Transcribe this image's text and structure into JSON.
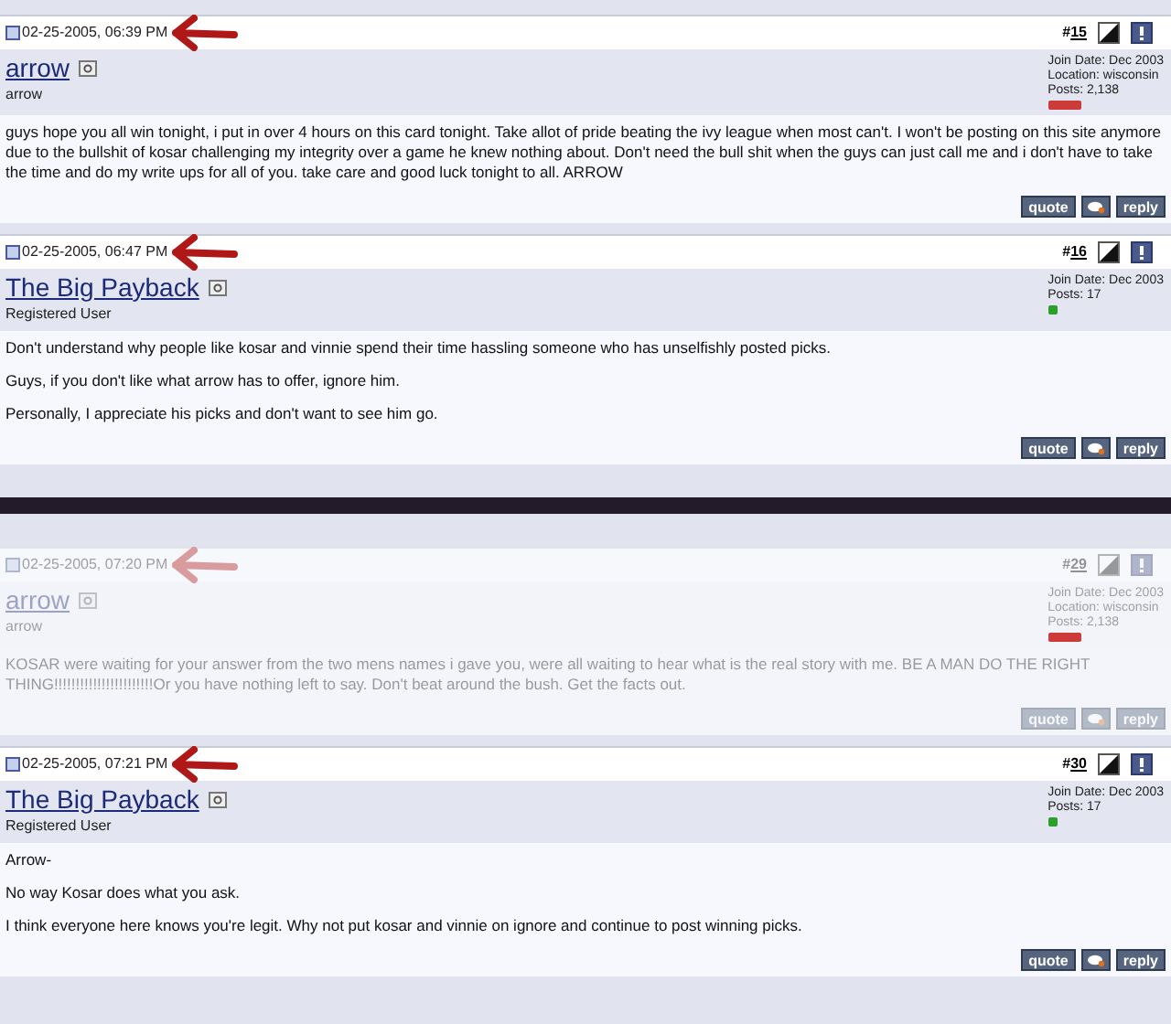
{
  "posts": [
    {
      "date": "02-25-2005, 06:39 PM",
      "hash": "#",
      "number": "15",
      "username": "arrow",
      "user_title": "arrow",
      "faded": false,
      "color": "#cc3a3a",
      "stats": [
        "Join Date: Dec 2003",
        "Location: wisconsin",
        "Posts: 2,138"
      ],
      "paragraphs": [
        "guys hope you all win tonight, i put in over 4 hours on this card tonight. Take allot of pride beating the ivy league when most can't. I won't be posting on this site anymore due to the bullshit of kosar challenging my integrity over a game he knew nothing about. Don't need the bull shit when the guys can just call me and i don't have to take the time and do my write ups for all of you. take care and good luck tonight to all. ARROW"
      ],
      "buttons": [
        "quote",
        "reply"
      ]
    },
    {
      "date": "02-25-2005, 06:47 PM",
      "hash": "#",
      "number": "16",
      "username": "The Big Payback",
      "user_title": "Registered User",
      "faded": false,
      "color": "#2aa02a",
      "stats": [
        "Join Date: Dec 2003",
        "Posts: 17"
      ],
      "paragraphs": [
        "Don't understand why people like kosar and vinnie spend their time hassling someone who has unselfishly posted picks.",
        "Guys, if you don't like what arrow has to offer, ignore him.",
        "Personally, I appreciate his picks and don't want to see him go."
      ],
      "buttons": [
        "quote",
        "reply"
      ],
      "divider_after": true
    },
    {
      "date": "02-25-2005, 07:20 PM",
      "hash": "#",
      "number": "29",
      "username": "arrow",
      "user_title": "arrow",
      "faded": true,
      "color": "#cc3a3a",
      "stats": [
        "Join Date: Dec 2003",
        "Location: wisconsin",
        "Posts: 2,138"
      ],
      "paragraphs": [
        "KOSAR were waiting for your answer from the two mens names i gave you, were all waiting to hear what is the real story with me. BE A MAN DO THE RIGHT THING!!!!!!!!!!!!!!!!!!!!!!!Or you have nothing left to say. Don't beat around the bush. Get the facts out."
      ],
      "buttons": [
        "quote",
        "reply"
      ]
    },
    {
      "date": "02-25-2005, 07:21 PM",
      "hash": "#",
      "number": "30",
      "username": "The Big Payback",
      "user_title": "Registered User",
      "faded": false,
      "color": "#2aa02a",
      "stats": [
        "Join Date: Dec 2003",
        "Posts: 17"
      ],
      "paragraphs": [
        "Arrow-",
        "No way Kosar does what you ask.",
        "I think everyone here knows you're legit. Why not put kosar and vinnie on ignore and continue to post winning picks."
      ],
      "buttons": [
        "quote",
        "reply"
      ]
    }
  ]
}
